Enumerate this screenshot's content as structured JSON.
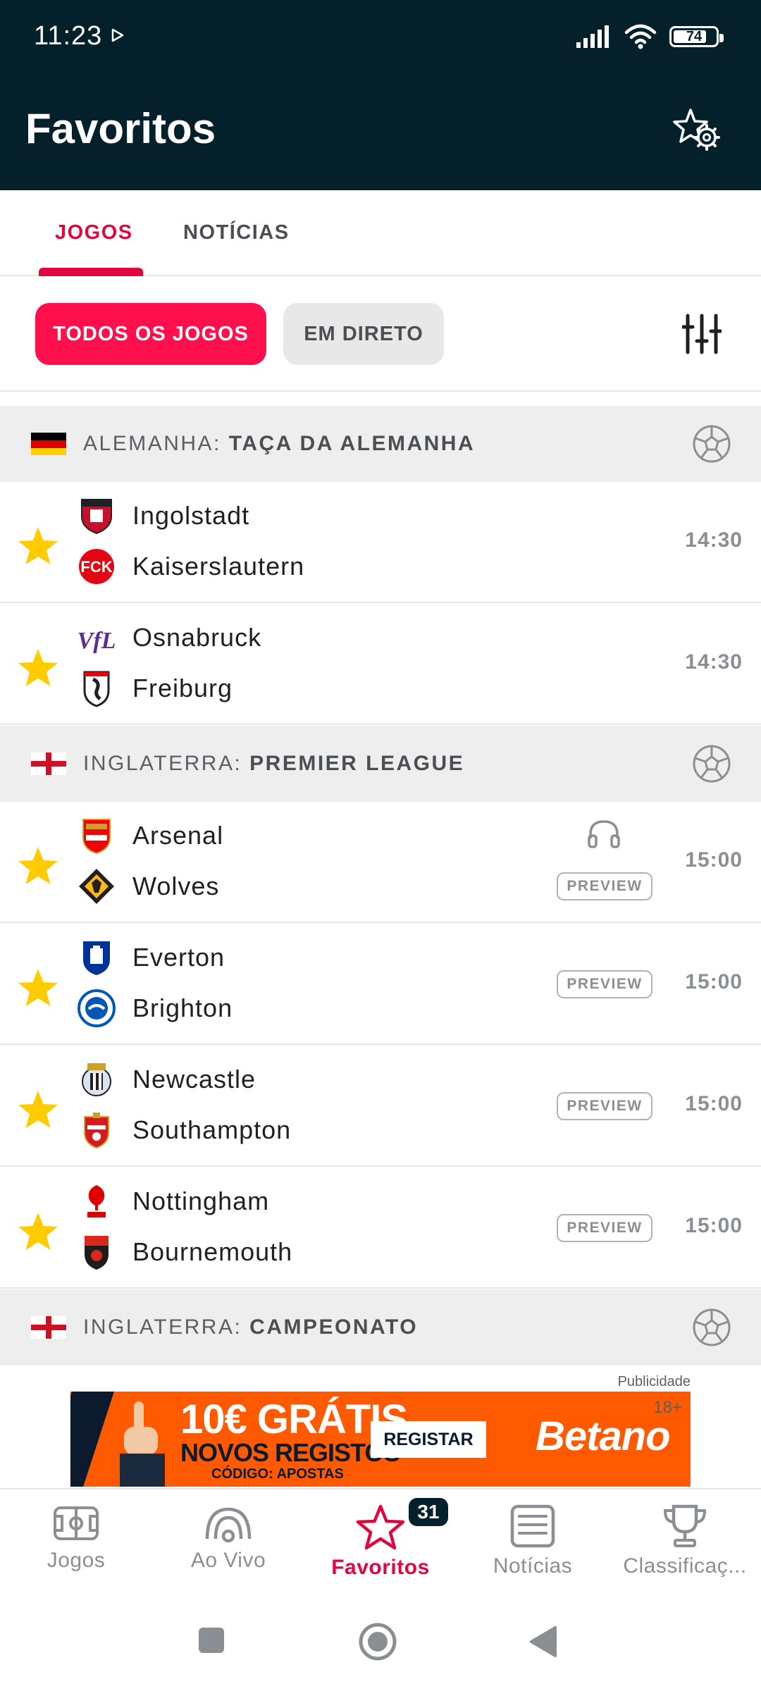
{
  "status_bar": {
    "time": "11:23",
    "battery": "74"
  },
  "header": {
    "title": "Favoritos"
  },
  "tabs": [
    {
      "label": "JOGOS",
      "active": true
    },
    {
      "label": "NOTÍCIAS",
      "active": false
    }
  ],
  "filters": {
    "all_label": "TODOS OS JOGOS",
    "live_label": "EM DIRETO"
  },
  "leagues": [
    {
      "country": "ALEMANHA:",
      "competition": "TAÇA DA ALEMANHA",
      "matches": [
        {
          "home": "Ingolstadt",
          "away": "Kaiserslautern",
          "time": "14:30"
        },
        {
          "home": "Osnabruck",
          "away": "Freiburg",
          "time": "14:30"
        }
      ]
    },
    {
      "country": "INGLATERRA:",
      "competition": "PREMIER LEAGUE",
      "matches": [
        {
          "home": "Arsenal",
          "away": "Wolves",
          "time": "15:00",
          "preview": "PREVIEW",
          "audio": true
        },
        {
          "home": "Everton",
          "away": "Brighton",
          "time": "15:00",
          "preview": "PREVIEW"
        },
        {
          "home": "Newcastle",
          "away": "Southampton",
          "time": "15:00",
          "preview": "PREVIEW"
        },
        {
          "home": "Nottingham",
          "away": "Bournemouth",
          "time": "15:00",
          "preview": "PREVIEW"
        }
      ]
    },
    {
      "country": "INGLATERRA:",
      "competition": "CAMPEONATO",
      "matches": []
    }
  ],
  "ad": {
    "label": "Publicidade",
    "age": "18+",
    "headline": "10€ GRÁTIS",
    "subline": "NOVOS REGISTOS",
    "code": "CÓDIGO: APOSTAS",
    "cta": "REGISTAR",
    "brand": "Betano"
  },
  "bottom_nav": {
    "items": [
      {
        "label": "Jogos",
        "icon": "pitch-icon"
      },
      {
        "label": "Ao Vivo",
        "icon": "broadcast-icon"
      },
      {
        "label": "Favoritos",
        "icon": "star-icon",
        "active": true
      },
      {
        "label": "Notícias",
        "icon": "newspaper-icon"
      },
      {
        "label": "Classificaç...",
        "icon": "trophy-icon"
      }
    ],
    "badge": "31"
  },
  "colors": {
    "header_bg": "#04202a",
    "accent": "#e0073f",
    "pill_active": "#ff0f4b",
    "star": "#ffcc00"
  }
}
